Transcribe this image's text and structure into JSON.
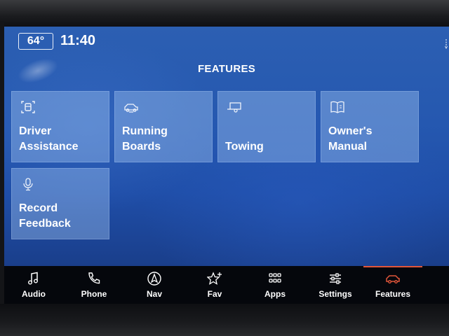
{
  "status_bar": {
    "temperature": "64°",
    "time": "11:40"
  },
  "page": {
    "title": "FEATURES"
  },
  "tiles": [
    {
      "label": "Driver\nAssistance",
      "icon": "driver-assistance-icon"
    },
    {
      "label": "Running Boards",
      "icon": "running-boards-icon"
    },
    {
      "label": "Towing",
      "icon": "trailer-icon"
    },
    {
      "label": "Owner's Manual",
      "icon": "book-icon"
    },
    {
      "label": "Record\nFeedback",
      "icon": "microphone-icon"
    }
  ],
  "nav": {
    "items": [
      {
        "label": "Audio",
        "icon": "music-note-icon"
      },
      {
        "label": "Phone",
        "icon": "phone-icon"
      },
      {
        "label": "Nav",
        "icon": "navigation-icon"
      },
      {
        "label": "Fav",
        "icon": "star-plus-icon"
      },
      {
        "label": "Apps",
        "icon": "apps-grid-icon"
      },
      {
        "label": "Settings",
        "icon": "sliders-icon"
      },
      {
        "label": "Features",
        "icon": "vehicle-icon"
      }
    ],
    "active": "Features",
    "accent_color": "#e2563a"
  },
  "colors": {
    "background_top": "#2c5fb2",
    "background_bottom": "#15336f",
    "tile": "#a0c3f0",
    "navbar": "#05070c"
  }
}
